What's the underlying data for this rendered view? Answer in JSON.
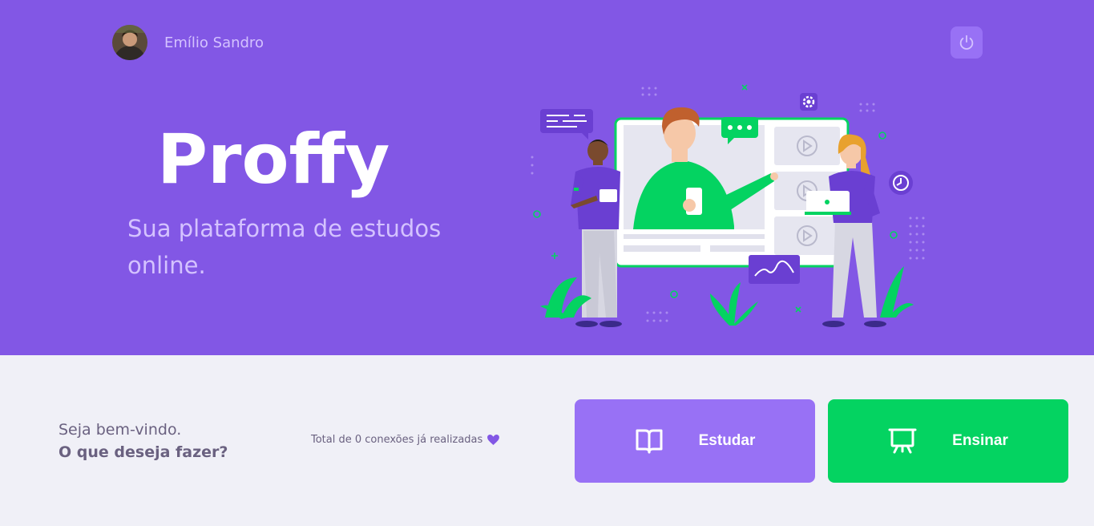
{
  "user": {
    "name": "Emílio Sandro"
  },
  "hero": {
    "logo_text": "Proffy",
    "tagline": "Sua plataforma de estudos online."
  },
  "footer": {
    "welcome_line1": "Seja bem-vindo.",
    "welcome_line2": "O que deseja fazer?",
    "connections_text": "Total de 0 conexões já realizadas"
  },
  "buttons": {
    "study": {
      "label": "Estudar",
      "icon": "book-icon"
    },
    "teach": {
      "label": "Ensinar",
      "icon": "presentation-icon"
    }
  },
  "icons": {
    "logout": "power-icon",
    "heart": "heart-icon"
  },
  "colors": {
    "primary": "#8257E5",
    "primary_light": "#9871F5",
    "secondary": "#04D361",
    "background": "#F0F0F7",
    "text_light": "#D4C2FF",
    "text_base": "#6A6180"
  }
}
